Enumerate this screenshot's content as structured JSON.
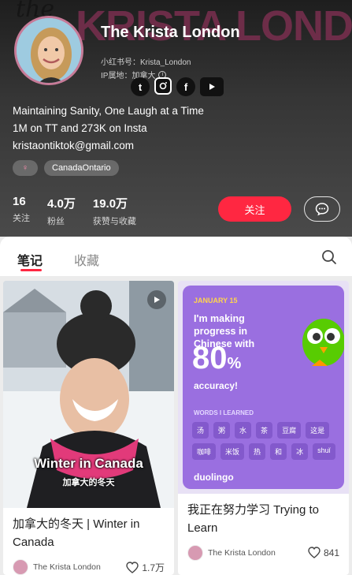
{
  "profile": {
    "banner_text": "KRISTA LONDON",
    "banner_script": "the",
    "name": "The Krista London",
    "xhs_id": "小红书号：Krista_London",
    "ip_location": "IP属地：加拿大",
    "social_icons": [
      "tiktok-icon",
      "instagram-icon",
      "facebook-icon",
      "youtube-icon"
    ],
    "bio_lines": [
      "Maintaining Sanity, One Laugh at a Time",
      "1M on TT and 273K on Insta",
      "kristaontiktok@gmail.com"
    ],
    "tags": {
      "gender_symbol": "♀",
      "location": "CanadaOntario"
    },
    "stats": [
      {
        "value": "16",
        "label": "关注"
      },
      {
        "value": "4.0万",
        "label": "粉丝"
      },
      {
        "value": "19.0万",
        "label": "获赞与收藏"
      }
    ],
    "follow_label": "关注"
  },
  "tabs": {
    "notes": "笔记",
    "collections": "收藏"
  },
  "feed": [
    {
      "overlay_title": "Winter in Canada",
      "overlay_subtitle": "加拿大的冬天",
      "title": "加拿大的冬天 | Winter in Canada",
      "author": "The Krista London",
      "likes": "1.7万"
    },
    {
      "duo_date": "JANUARY 15",
      "duo_heading": "I'm making progress in Chinese with",
      "duo_percent": "80",
      "duo_percent_sign": "%",
      "duo_accuracy": "accuracy!",
      "duo_words_label": "WORDS I LEARNED",
      "duo_words": [
        "汤",
        "粥",
        "水",
        "茶",
        "豆腐",
        "这是",
        "咖啡",
        "米饭",
        "热",
        "和",
        "冰",
        "shuǐ"
      ],
      "duo_logo": "duolingo",
      "title": "我正在努力学习 Trying to Learn",
      "author": "The Krista London",
      "likes": "841"
    }
  ],
  "colors": {
    "accent": "#ff2741",
    "duolingo_purple": "#9a6fe0",
    "duolingo_green": "#58cc02"
  }
}
